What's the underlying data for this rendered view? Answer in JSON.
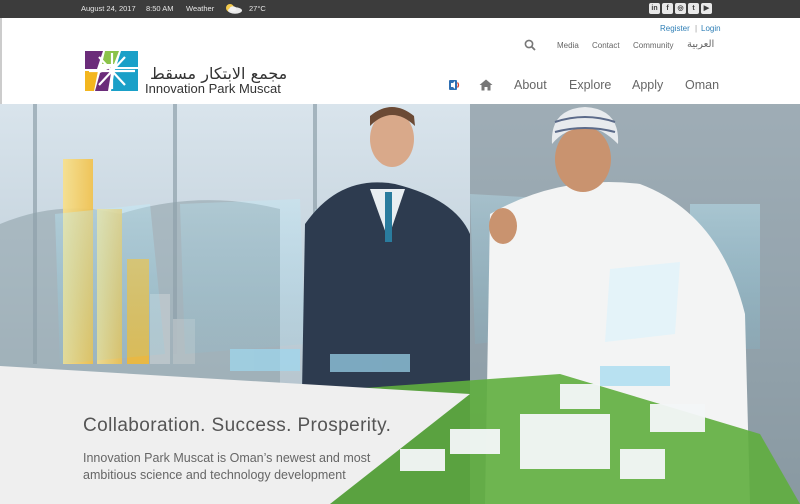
{
  "topbar": {
    "date": "August 24, 2017",
    "time": "8:50 AM",
    "weather_label": "Weather",
    "temperature": "27°C",
    "weather_icon": "partly-cloudy-icon",
    "social": [
      {
        "name": "linkedin-icon",
        "glyph": "in"
      },
      {
        "name": "facebook-icon",
        "glyph": "f"
      },
      {
        "name": "instagram-icon",
        "glyph": "◎"
      },
      {
        "name": "twitter-icon",
        "glyph": "t"
      },
      {
        "name": "youtube-icon",
        "glyph": "▶"
      }
    ]
  },
  "header": {
    "register": "Register",
    "login": "Login",
    "separator": "|",
    "utility_links": [
      "Media",
      "Contact",
      "Community"
    ],
    "language": "العربية",
    "logo_arabic": "مجمع الابتكار مسقط",
    "logo_english": "Innovation Park Muscat",
    "nav": [
      "About",
      "Explore",
      "Apply",
      "Oman"
    ]
  },
  "hero": {
    "headline": "Collaboration. Success. Prosperity.",
    "subcopy": "Innovation Park Muscat is Oman’s newest and most ambitious science and technology development"
  },
  "colors": {
    "topbar_bg": "#3c3c3c",
    "link_blue": "#2f7fb6",
    "logo_green": "#8bc34a",
    "logo_purple": "#6b2c7a",
    "logo_yellow": "#f3b61f",
    "logo_teal": "#1aa0c8"
  }
}
